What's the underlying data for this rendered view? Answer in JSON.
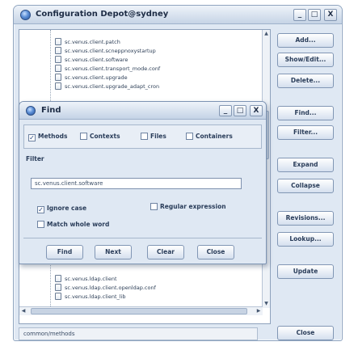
{
  "window": {
    "title": "Configuration Depot@sydney",
    "minimize": "_",
    "maximize": "□",
    "close": "X"
  },
  "tree": {
    "top_items": [
      "sc.venus.client.patch",
      "sc.venus.client.scneppnoxystartup",
      "sc.venus.client.software",
      "sc.venus.client.transport_mode.conf",
      "sc.venus.client.upgrade",
      "sc.venus.client.upgrade_adapt_cron"
    ],
    "bottom_items": [
      "sc.venus.ldap.client",
      "sc.venus.ldap.client.openldap.conf",
      "sc.venus.ldap.client_lib"
    ]
  },
  "status": "common/methods",
  "side_buttons": {
    "add": "Add...",
    "show_edit": "Show/Edit...",
    "delete": "Delete...",
    "find": "Find...",
    "filter": "Filter...",
    "expand": "Expand",
    "collapse": "Collapse",
    "revisions": "Revisions...",
    "lookup": "Lookup...",
    "update": "Update",
    "close": "Close"
  },
  "find_dialog": {
    "title": "Find",
    "scope_options": [
      {
        "label": "Methods",
        "checked": true
      },
      {
        "label": "Contexts",
        "checked": false
      },
      {
        "label": "Files",
        "checked": false
      },
      {
        "label": "Containers",
        "checked": false
      }
    ],
    "filter_label": "Filter",
    "filter_value": "sc.venus.client.software",
    "ignore_case": "Ignore case",
    "ignore_case_checked": true,
    "regular_expression": "Regular expression",
    "regular_expression_checked": false,
    "match_whole_word": "Match whole word",
    "match_whole_word_checked": false,
    "buttons": {
      "find": "Find",
      "next": "Next",
      "clear": "Clear",
      "close": "Close"
    }
  }
}
